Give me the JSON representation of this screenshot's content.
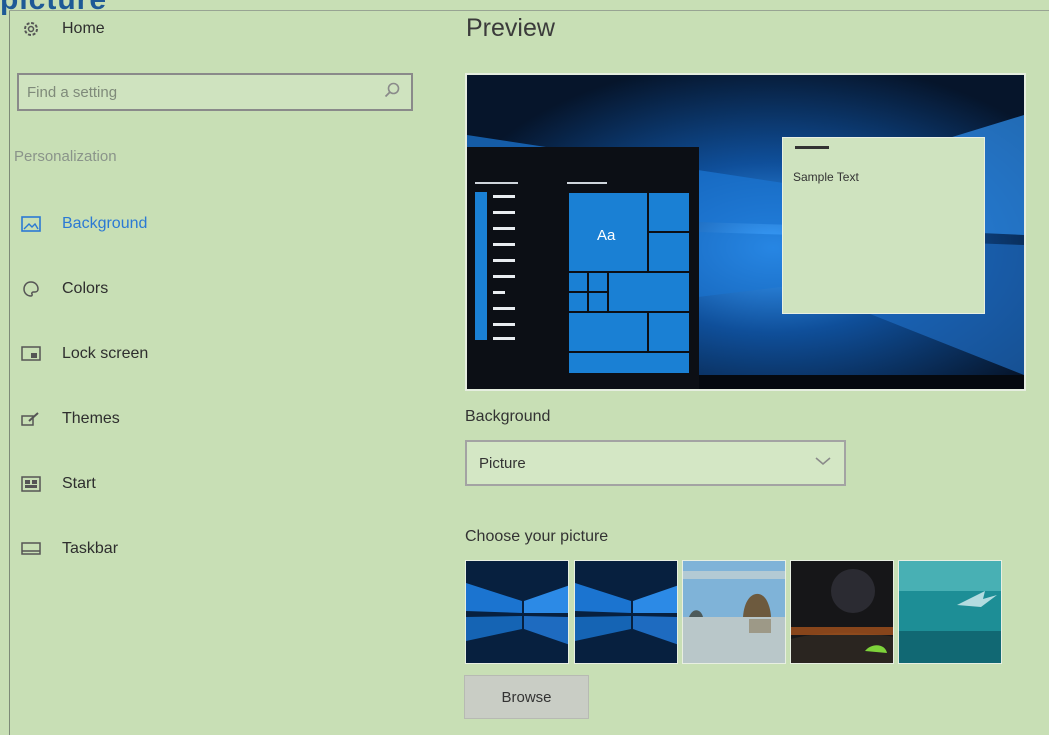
{
  "caption": "picture",
  "sidebar": {
    "home_label": "Home",
    "search_placeholder": "Find a setting",
    "section_label": "Personalization",
    "items": [
      {
        "label": "Background",
        "icon": "picture-icon",
        "active": true
      },
      {
        "label": "Colors",
        "icon": "palette-icon",
        "active": false
      },
      {
        "label": "Lock screen",
        "icon": "lock-screen-icon",
        "active": false
      },
      {
        "label": "Themes",
        "icon": "brush-icon",
        "active": false
      },
      {
        "label": "Start",
        "icon": "start-icon",
        "active": false
      },
      {
        "label": "Taskbar",
        "icon": "taskbar-icon",
        "active": false
      }
    ]
  },
  "main": {
    "heading": "Preview",
    "preview": {
      "sample_text": "Sample Text",
      "tile_text": "Aa"
    },
    "background_label": "Background",
    "background_value": "Picture",
    "choose_label": "Choose your picture",
    "pictures": [
      "windows-hero-1",
      "windows-hero-2",
      "beach-rock",
      "night-sky",
      "underwater"
    ],
    "browse_label": "Browse"
  },
  "colors": {
    "background": "#c8dfb5",
    "accent": "#2b79d4",
    "tile_blue": "#1a80d4"
  }
}
